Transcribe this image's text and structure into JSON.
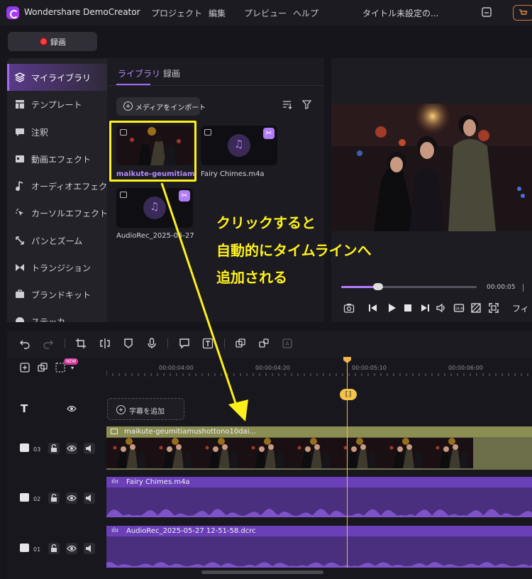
{
  "app": {
    "title": "Wondershare DemoCreator",
    "menu": [
      "プロジェクト",
      "編集",
      "プレビュー",
      "ヘルプ"
    ],
    "document_title": "タイトル未設定の..."
  },
  "record": {
    "label": "録画"
  },
  "sidebar": {
    "items": [
      {
        "label": "マイライブラリ",
        "icon": "library-icon"
      },
      {
        "label": "テンプレート",
        "icon": "template-icon"
      },
      {
        "label": "注釈",
        "icon": "annotation-icon"
      },
      {
        "label": "動画エフェクト",
        "icon": "video-effect-icon"
      },
      {
        "label": "オーディオエフェクト",
        "icon": "audio-effect-icon"
      },
      {
        "label": "カーソルエフェクト",
        "icon": "cursor-effect-icon"
      },
      {
        "label": "パンとズーム",
        "icon": "pan-zoom-icon"
      },
      {
        "label": "トランジション",
        "icon": "transition-icon"
      },
      {
        "label": "ブランドキット",
        "icon": "brand-kit-icon"
      },
      {
        "label": "ステッカ",
        "icon": "sticker-icon"
      }
    ]
  },
  "library": {
    "tabs": [
      "ライブラリ",
      "録画"
    ],
    "import_label": "メディアをインポート",
    "items": [
      {
        "name": "maikute-geumitiamu..."
      },
      {
        "name": "Fairy Chimes.m4a"
      },
      {
        "name": "AudioRec_2025-05-27..."
      }
    ]
  },
  "preview": {
    "current_time": "00:00:05",
    "fit_label": "フィ",
    "progress": 0.27
  },
  "timeline": {
    "new_badge": "NEW",
    "ruler": [
      "00:00:04:00",
      "00:00:04:20",
      "00:00:05:10",
      "00:00:06:00"
    ],
    "subtitle_add": "字幕を追加",
    "tracks": [
      {
        "num": "03",
        "clip": "maikute-geumitiamushottono10dai..."
      },
      {
        "num": "02",
        "clip": "Fairy Chimes.m4a"
      },
      {
        "num": "01",
        "clip": "AudioRec_2025-05-27 12-51-58.dcrc"
      }
    ]
  },
  "annotation": {
    "lines": [
      "クリックすると",
      "自動的にタイムラインへ",
      "追加される"
    ],
    "color": "#fff21c"
  }
}
